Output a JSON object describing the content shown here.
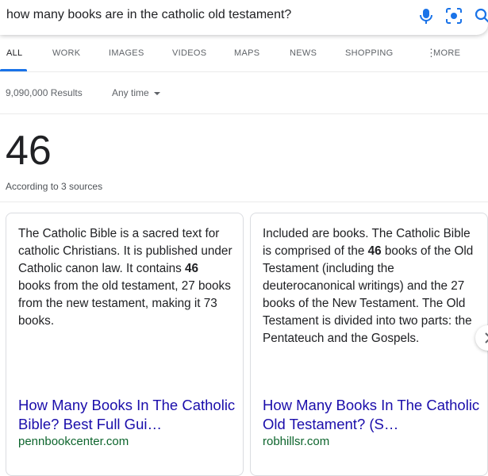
{
  "search": {
    "query": "how many books are in the catholic old testament?",
    "icons": [
      "mic-icon",
      "lens-icon",
      "search-icon"
    ],
    "colors": {
      "mic": "#4285f4",
      "lens": "#1a73e8"
    }
  },
  "tabs": [
    {
      "label": "ALL",
      "active": true
    },
    {
      "label": "WORK"
    },
    {
      "label": "IMAGES"
    },
    {
      "label": "VIDEOS"
    },
    {
      "label": "MAPS"
    },
    {
      "label": "NEWS"
    },
    {
      "label": "SHOPPING"
    },
    {
      "label": "MORE"
    }
  ],
  "stats": {
    "result_count": "9,090,000 Results",
    "time_filter": "Any time"
  },
  "answer": {
    "value": "46",
    "sources": "According to 3 sources"
  },
  "cards": [
    {
      "text_before": "The Catholic Bible is a sacred text for catholic Christians. It is published under Catholic canon law. It contains ",
      "highlight": "46",
      "text_after": " books from the old testament, 27 books from the new testament, making it 73 books.",
      "title": "How Many Books In The Catholic Bible? Best Full Gui…",
      "domain": "pennbookcenter.com"
    },
    {
      "text_before": "Included are books. The Catholic Bible is comprised of the ",
      "highlight": "46",
      "text_after": " books of the Old Testament (including the deuterocanonical writings) and the 27 books of the New Testament. The Old Testament is divided into two parts: the Pentateuch and the Gospels.",
      "title": "How Many Books In The Catholic Old Testament? (S…",
      "domain": "robhillsr.com"
    }
  ],
  "colors": {
    "link": "#1a0dab",
    "domain": "#0d652d",
    "accent": "#1a73e8"
  }
}
